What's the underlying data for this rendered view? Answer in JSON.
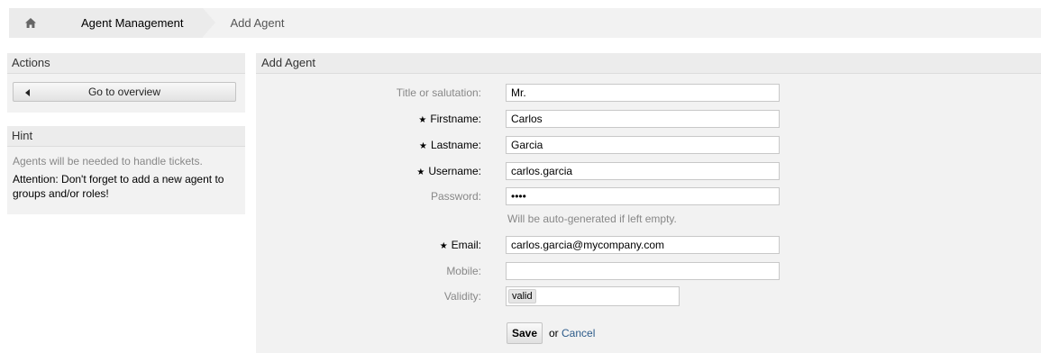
{
  "breadcrumb": {
    "home_icon": "home-icon",
    "items": [
      {
        "label": "Agent Management"
      },
      {
        "label": "Add Agent"
      }
    ]
  },
  "sidebar": {
    "actions": {
      "title": "Actions",
      "go_to_overview": "Go to overview"
    },
    "hint": {
      "title": "Hint",
      "text1": "Agents will be needed to handle tickets.",
      "text2": "Attention: Don't forget to add a new agent to groups and/or roles!"
    }
  },
  "form": {
    "title": "Add Agent",
    "fields": {
      "title": {
        "label": "Title or salutation:",
        "value": "Mr."
      },
      "firstname": {
        "label": "Firstname:",
        "value": "Carlos"
      },
      "lastname": {
        "label": "Lastname:",
        "value": "Garcia"
      },
      "username": {
        "label": "Username:",
        "value": "carlos.garcia"
      },
      "password": {
        "label": "Password:",
        "value": "••••",
        "hint": "Will be auto-generated if left empty."
      },
      "email": {
        "label": "Email:",
        "value": "carlos.garcia@mycompany.com"
      },
      "mobile": {
        "label": "Mobile:",
        "value": ""
      },
      "validity": {
        "label": "Validity:",
        "value": "valid"
      }
    },
    "required_marker": "★",
    "save_label": "Save",
    "or_label": "or",
    "cancel_label": "Cancel"
  },
  "colors": {
    "panel": "#f2f2f2",
    "link": "#2c5b8a",
    "muted": "#888888"
  }
}
